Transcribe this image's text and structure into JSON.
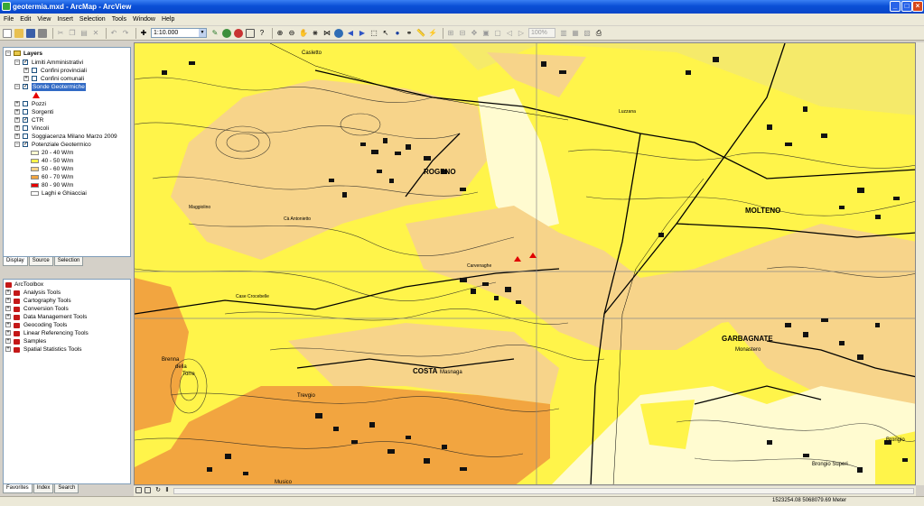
{
  "window": {
    "title": "geotermia.mxd - ArcMap - ArcView"
  },
  "menu": [
    "File",
    "Edit",
    "View",
    "Insert",
    "Selection",
    "Tools",
    "Window",
    "Help"
  ],
  "toolbar": {
    "scale": "1:10.000",
    "zoom_percent": "100%"
  },
  "toc": {
    "root": "Layers",
    "groups": [
      {
        "label": "Limiti Amministrativi",
        "checked": true,
        "expanded": true
      },
      {
        "label": "Confini provinciali",
        "checked": false,
        "expanded": false
      },
      {
        "label": "Confini comunali",
        "checked": false,
        "expanded": false
      },
      {
        "label": "Sonde Geotermiche",
        "checked": true,
        "expanded": true,
        "selected": true
      },
      {
        "label": "Pozzi",
        "checked": false
      },
      {
        "label": "Sorgenti",
        "checked": false
      },
      {
        "label": "CTR",
        "checked": true
      },
      {
        "label": "Vincoli",
        "checked": false
      },
      {
        "label": "Soggiacenza Milano Marzo 2009",
        "checked": false
      },
      {
        "label": "Potenziale Geotermico",
        "checked": true,
        "expanded": true
      }
    ],
    "legend": [
      {
        "label": "20 - 40 W/m",
        "color": "#fffbd0"
      },
      {
        "label": "40 - 50 W/m",
        "color": "#fff44a"
      },
      {
        "label": "50 - 60 W/m",
        "color": "#f7d48a"
      },
      {
        "label": "60 - 70 W/m",
        "color": "#f2a540"
      },
      {
        "label": "80 - 90 W/m",
        "color": "#e60000"
      },
      {
        "label": "Laghi e Ghiacciai",
        "color": "#ffffff"
      }
    ],
    "tabs": [
      "Display",
      "Source",
      "Selection"
    ]
  },
  "toolbox": {
    "root": "ArcToolbox",
    "items": [
      "Analysis Tools",
      "Cartography Tools",
      "Conversion Tools",
      "Data Management Tools",
      "Geocoding Tools",
      "Linear Referencing Tools",
      "Samples",
      "Spatial Statistics Tools"
    ],
    "tabs": [
      "Favorites",
      "Index",
      "Search"
    ]
  },
  "map": {
    "places": [
      "ROGENO",
      "MOLTENO",
      "GARBAGNATE",
      "Monastero",
      "COSTA",
      "Masnaga",
      "Brenna",
      "della",
      "Torre",
      "Casletto",
      "Maggiolino",
      "Cà Antonietto",
      "Case Crocebelle",
      "Carvenaghe",
      "Trevgio",
      "Brongio",
      "Brongio Superi",
      "Musico",
      "Luzzana"
    ]
  },
  "status": {
    "coordinates": "1523254.08  5068079.69 Meter"
  }
}
